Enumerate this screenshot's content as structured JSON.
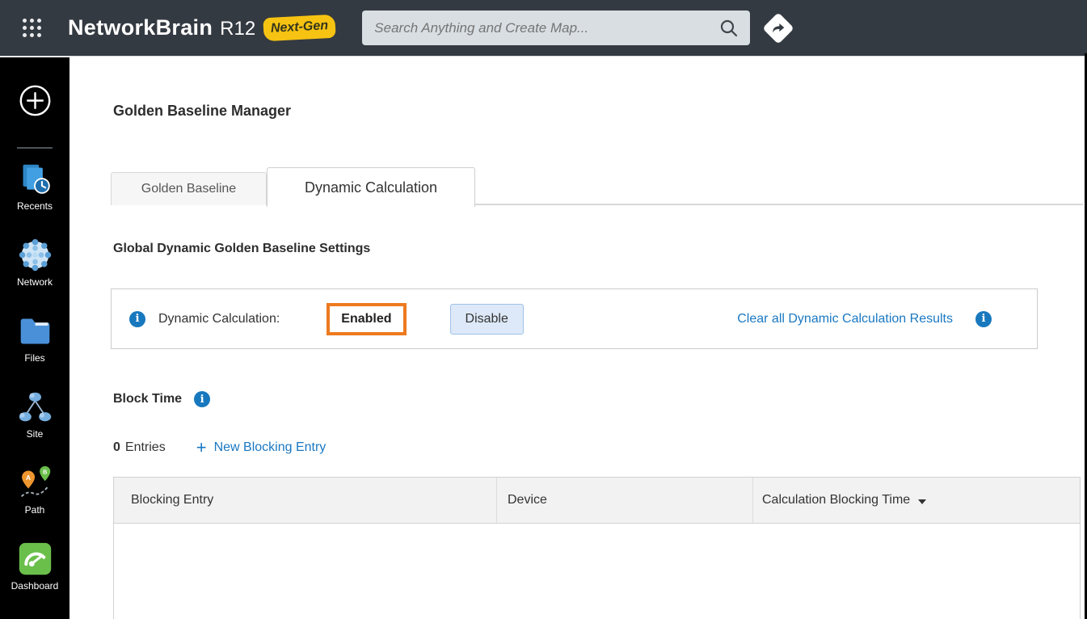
{
  "topbar": {
    "logo_text": "NetworkBrain",
    "logo_version": "R12",
    "badge": "Next-Gen",
    "search_placeholder": "Search Anything and Create Map..."
  },
  "sidebar": {
    "items": [
      {
        "label": "Recents"
      },
      {
        "label": "Network"
      },
      {
        "label": "Files"
      },
      {
        "label": "Site"
      },
      {
        "label": "Path"
      },
      {
        "label": "Dashboard"
      }
    ]
  },
  "main": {
    "title": "Golden Baseline Manager",
    "tabs": [
      {
        "label": "Golden Baseline",
        "active": false
      },
      {
        "label": "Dynamic Calculation",
        "active": true
      }
    ],
    "settings": {
      "heading": "Global Dynamic Golden Baseline Settings",
      "label": "Dynamic Calculation:",
      "status": "Enabled",
      "disable_button": "Disable",
      "clear_link": "Clear all Dynamic Calculation Results"
    },
    "block_time": {
      "heading": "Block Time",
      "entries_count": "0",
      "entries_label": "Entries",
      "plus_icon": "+",
      "new_entry_link": "New Blocking Entry"
    },
    "table": {
      "columns": [
        "Blocking Entry",
        "Device",
        "Calculation Blocking Time"
      ]
    }
  },
  "icons": {
    "info_glyph": "i",
    "pin_a": "A",
    "pin_b": "B"
  },
  "colors": {
    "topbar_bg": "#343a41",
    "sidebar_bg": "#000000",
    "badge_yellow": "#f7c312",
    "link_blue": "#1a78c2",
    "info_blue": "#1878be",
    "highlight_orange": "#ee7a1e",
    "button_blue_bg": "#dde9f8",
    "dashboard_green": "#6abf4b",
    "path_pin_orange": "#f0962e"
  }
}
